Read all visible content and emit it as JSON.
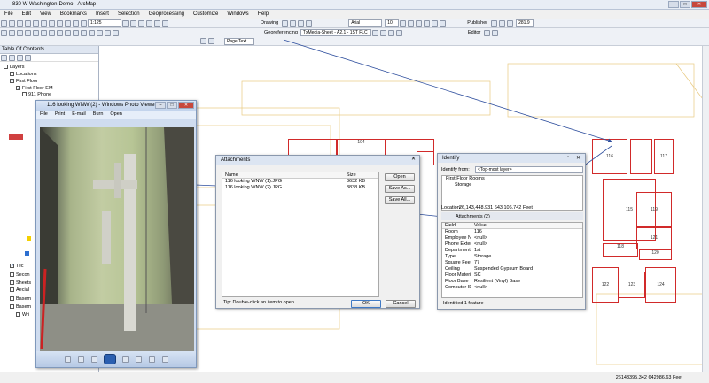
{
  "app": {
    "title": "830 W Washington-Demo - ArcMap"
  },
  "menu": [
    "File",
    "Edit",
    "View",
    "Bookmarks",
    "Insert",
    "Selection",
    "Geoprocessing",
    "Customize",
    "Windows",
    "Help"
  ],
  "toolbar": {
    "scale": "1:125",
    "drawing": "Drawing",
    "font": "Arial",
    "font_size": "10",
    "publisher": "Publisher",
    "editor": "Editor",
    "georef": "Georeferencing",
    "layer_combo": "TxMedia-Sheet - A2.1 - 1ST FLC",
    "page_text": "Page Text",
    "zoom": "281.9"
  },
  "toc": {
    "title": "Table Of Contents",
    "items": [
      {
        "label": "Layers",
        "indent": 0,
        "checked": false
      },
      {
        "label": "Locations",
        "indent": 1,
        "checked": false
      },
      {
        "label": "First Floor",
        "indent": 1,
        "checked": true
      },
      {
        "label": "First Floor EM",
        "indent": 2,
        "checked": true
      },
      {
        "label": "911 Phone",
        "indent": 3,
        "checked": false
      },
      {
        "label": "Tec",
        "indent": 1,
        "checked": true
      },
      {
        "label": "Secon",
        "indent": 1,
        "checked": false
      },
      {
        "label": "Sheets",
        "indent": 1,
        "checked": false
      },
      {
        "label": "Aecial",
        "indent": 1,
        "checked": false
      },
      {
        "label": "Basem",
        "indent": 1,
        "checked": false
      },
      {
        "label": "Basem",
        "indent": 1,
        "checked": false
      },
      {
        "label": "Wri",
        "indent": 2,
        "checked": false
      }
    ]
  },
  "photo_viewer": {
    "title": "116 looking WNW (2) - Windows Photo Viewer",
    "menu": [
      "File",
      "Print",
      "E-mail",
      "Burn",
      "Open"
    ]
  },
  "attachments": {
    "title": "Attachments",
    "col_name": "Name",
    "col_size": "Size",
    "files": [
      {
        "name": "116 looking WNW (1).JPG",
        "size": "3632 KB"
      },
      {
        "name": "116 looking WNW (2).JPG",
        "size": "3838 KB"
      }
    ],
    "btn_open": "Open",
    "btn_save_as": "Save As...",
    "btn_save_all": "Save All...",
    "tip": "Tip:  Double-click an item to open.",
    "btn_ok": "OK",
    "btn_cancel": "Cancel"
  },
  "identify": {
    "title": "Identify",
    "identify_from_label": "Identify from:",
    "identify_from_value": "<Top-most layer>",
    "tree": [
      "First Floor Rooms",
      "Storage"
    ],
    "location_label": "Location:",
    "location_value": "26,143,448.931  643,106.742 Feet",
    "attachments_label": "Attachments (2)",
    "col_field": "Field",
    "col_value": "Value",
    "rows": [
      {
        "k": "Room",
        "v": "116"
      },
      {
        "k": "Employee Name",
        "v": "<null>"
      },
      {
        "k": "Phone Extension",
        "v": "<null>"
      },
      {
        "k": "Department",
        "v": "1st"
      },
      {
        "k": "Type",
        "v": "Storage"
      },
      {
        "k": "Square Feet",
        "v": "77"
      },
      {
        "k": "Ceiling",
        "v": "Suspended Gypsum Board"
      },
      {
        "k": "Floor Material",
        "v": "SC"
      },
      {
        "k": "Floor Base",
        "v": "Resilient (Vinyl) Base"
      },
      {
        "k": "Computer ID",
        "v": "<null>"
      }
    ],
    "footer": "Identified 1 feature"
  },
  "map_labels": {
    "r116": "116",
    "r117": "117",
    "r118": "118",
    "r119": "119",
    "r120": "120",
    "r121": "121",
    "r122": "122",
    "r123": "123",
    "r124": "124",
    "r115": "115",
    "r104": "104"
  },
  "status": {
    "coords": "26143395.342  642986.63 Feet"
  }
}
